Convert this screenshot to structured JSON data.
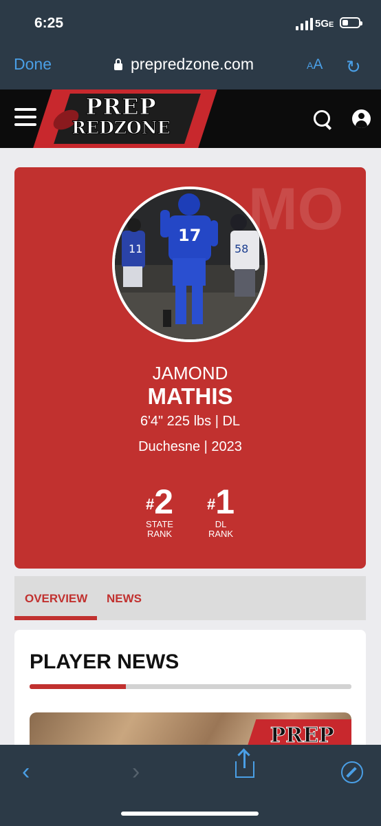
{
  "status_bar": {
    "time": "6:25",
    "network": "5G",
    "network_suffix": "E"
  },
  "browser": {
    "done_label": "Done",
    "url": "prepredzone.com",
    "text_size_label": "AA"
  },
  "site": {
    "logo_line1": "PREP",
    "logo_line2": "REDZONE"
  },
  "player": {
    "watermark": "MO",
    "first_name": "JAMOND",
    "last_name": "MATHIS",
    "measurements": "6'4\" 225 lbs | DL",
    "school_year": "Duchesne | 2023",
    "ranks": [
      {
        "value": "2",
        "label_line1": "STATE",
        "label_line2": "RANK"
      },
      {
        "value": "1",
        "label_line1": "DL",
        "label_line2": "RANK"
      }
    ]
  },
  "tabs": [
    {
      "label": "OVERVIEW",
      "active": true
    },
    {
      "label": "NEWS",
      "active": false
    }
  ],
  "news": {
    "heading": "PLAYER NEWS",
    "progress": 0.3,
    "logo_text": "PREP"
  },
  "colors": {
    "brand_red": "#c1312f",
    "ios_blue": "#4a9fe6",
    "dark_bar": "#2c3a47"
  },
  "photo_jerseys": {
    "main": "17",
    "left": "11",
    "right": "58"
  }
}
